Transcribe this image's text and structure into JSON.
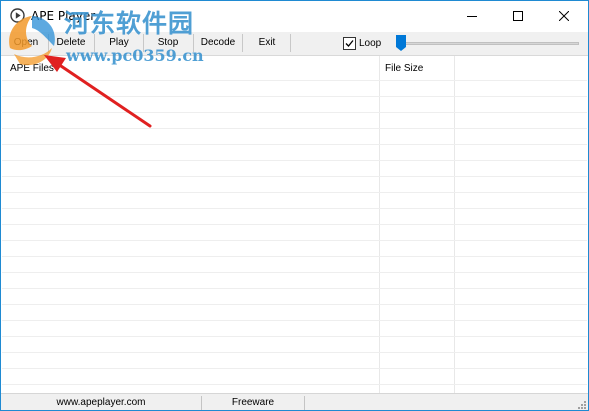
{
  "window": {
    "title": "APE Player",
    "minimize_icon": "minimize-icon",
    "maximize_icon": "maximize-icon",
    "close_icon": "close-icon"
  },
  "toolbar": {
    "open_label": "Open",
    "delete_label": "Delete",
    "play_label": "Play",
    "stop_label": "Stop",
    "decode_label": "Decode",
    "exit_label": "Exit",
    "loop_label": "Loop",
    "loop_checked": true,
    "volume_position": 0
  },
  "list": {
    "columns": [
      "APE Files",
      "File Size"
    ],
    "rows": []
  },
  "statusbar": {
    "website": "www.apeplayer.com",
    "license": "Freeware"
  },
  "watermark": {
    "text_cn": "河东软件园",
    "text_url": "www.pc0359.cn"
  },
  "colors": {
    "window_border": "#1f8ad2",
    "slider_thumb": "#0078d7",
    "watermark": "#3d95d0",
    "annotation_arrow": "#e02020"
  }
}
